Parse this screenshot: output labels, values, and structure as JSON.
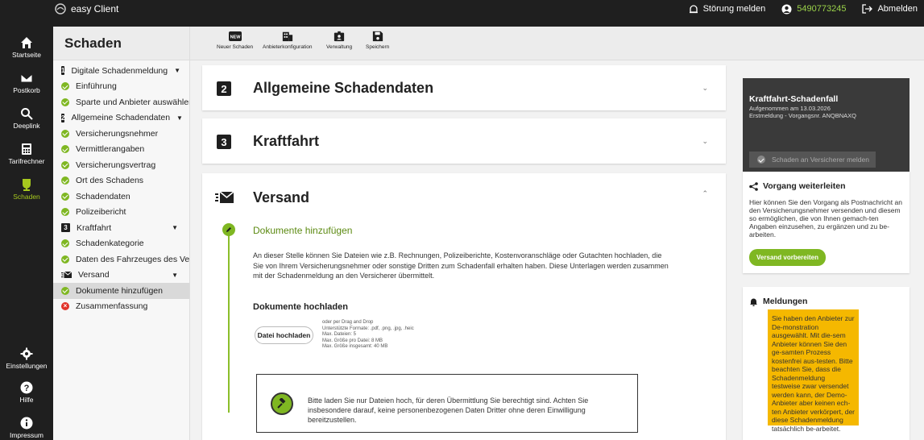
{
  "app": {
    "title": "easy Client"
  },
  "topbar": {
    "report_issue": "Störung melden",
    "user_id": "5490773245",
    "logout": "Abmelden"
  },
  "rail": [
    {
      "label": "Startseite",
      "icon": "home-icon"
    },
    {
      "label": "Postkorb",
      "icon": "mail-icon"
    },
    {
      "label": "Deeplink",
      "icon": "search-icon"
    },
    {
      "label": "Tarifrechner",
      "icon": "calculator-icon"
    },
    {
      "label": "Schaden",
      "icon": "umbrella-icon",
      "active": true
    },
    {
      "label": "Einstellungen",
      "icon": "gear-icon"
    },
    {
      "label": "Hilfe",
      "icon": "help-icon"
    },
    {
      "label": "Impressum",
      "icon": "info-icon"
    }
  ],
  "snav": {
    "title": "Schaden",
    "items": [
      {
        "type": "section",
        "num": "1",
        "label": "Digitale Schadenmeldung"
      },
      {
        "type": "done",
        "label": "Einführung"
      },
      {
        "type": "done",
        "label": "Sparte und Anbieter auswählen"
      },
      {
        "type": "section",
        "num": "2",
        "label": "Allgemeine Schadendaten"
      },
      {
        "type": "done",
        "label": "Versicherungsnehmer"
      },
      {
        "type": "done",
        "label": "Vermittlerangaben"
      },
      {
        "type": "done",
        "label": "Versicherungsvertrag"
      },
      {
        "type": "done",
        "label": "Ort des Schadens"
      },
      {
        "type": "done",
        "label": "Schadendaten"
      },
      {
        "type": "done",
        "label": "Polizeibericht"
      },
      {
        "type": "section",
        "num": "3",
        "label": "Kraftfahrt"
      },
      {
        "type": "done",
        "label": "Schadenkategorie"
      },
      {
        "type": "done",
        "label": "Daten des Fahrzeuges des Ver..."
      },
      {
        "type": "section-mail",
        "label": "Versand"
      },
      {
        "type": "done",
        "label": "Dokumente hinzufügen",
        "active": true
      },
      {
        "type": "error",
        "label": "Zusammenfassung"
      }
    ]
  },
  "toolbar": {
    "new_claim": "Neuer Schaden",
    "provider_config": "Anbieterkonfiguration",
    "admin": "Verwaltung",
    "save": "Speichern",
    "new_badge": "NEW"
  },
  "main": {
    "section2": {
      "num": "2",
      "title": "Allgemeine Schadendaten"
    },
    "section3": {
      "num": "3",
      "title": "Kraftfahrt"
    },
    "shipping": {
      "title": "Versand",
      "step_title": "Dokumente hinzufügen",
      "description": "An dieser Stelle können Sie Dateien wie z.B. Rechnungen, Polizeiberichte, Kostenvoranschläge oder Gutachten hochladen, die Sie von Ihrem Versicherungsnehmer oder sonstige Dritten zum Schadenfall erhalten haben. Diese Unterlagen werden zusammen mit der Schadenmeldung an den Versicherer übermittelt.",
      "upload_heading": "Dokumente hochladen",
      "upload_button": "Datei hochladen",
      "upload_hints": [
        "oder per Drag and Drop",
        "Unterstützte Formate: .pdf, .png, .jpg, .heic",
        "Max. Dateien: 5",
        "Max. Größe pro Datei: 8 MB",
        "Max. Größe insgesamt: 40 MB"
      ],
      "notice": "Bitte laden Sie nur Dateien hoch, für deren Übermittlung Sie berechtigt sind. Achten Sie insbesondere darauf, keine personenbezogenen Daten Dritter ohne deren Einwilligung bereitzustellen."
    }
  },
  "right": {
    "claim": {
      "title": "Kraftfahrt-Schadenfall",
      "recorded": "Aufgenommen am 13.03.2026",
      "meta": "Erstmeldung - Vorgangsnr. ANQBNAXQ",
      "report_button": "Schaden an Versicherer melden"
    },
    "forward": {
      "title": "Vorgang weiterleiten",
      "text": "Hier können Sie den Vorgang als Postnachricht an den Versicherungsnehmer versenden und diesem so ermöglichen, die von Ihnen gemach-ten Angaben einzusehen, zu ergänzen und zu be-arbeiten.",
      "button": "Versand vorbereiten"
    },
    "messages": {
      "title": "Meldungen",
      "text": "Sie haben den Anbieter zur De-monstration ausgewählt. Mit die-sem Anbieter können Sie den ge-samten Prozess kostenfrei aus-testen. Bitte beachten Sie, dass die Schadenmeldung testweise zwar versendet werden kann, der Demo-Anbieter aber keinen ech-ten Anbieter verkörpert, der diese Schadenmeldung tatsächlich be-arbeitet."
    }
  },
  "colors": {
    "accent": "#7fb722",
    "dark": "#1f1f1f",
    "warning": "#f5b800",
    "error": "#e2332a"
  }
}
